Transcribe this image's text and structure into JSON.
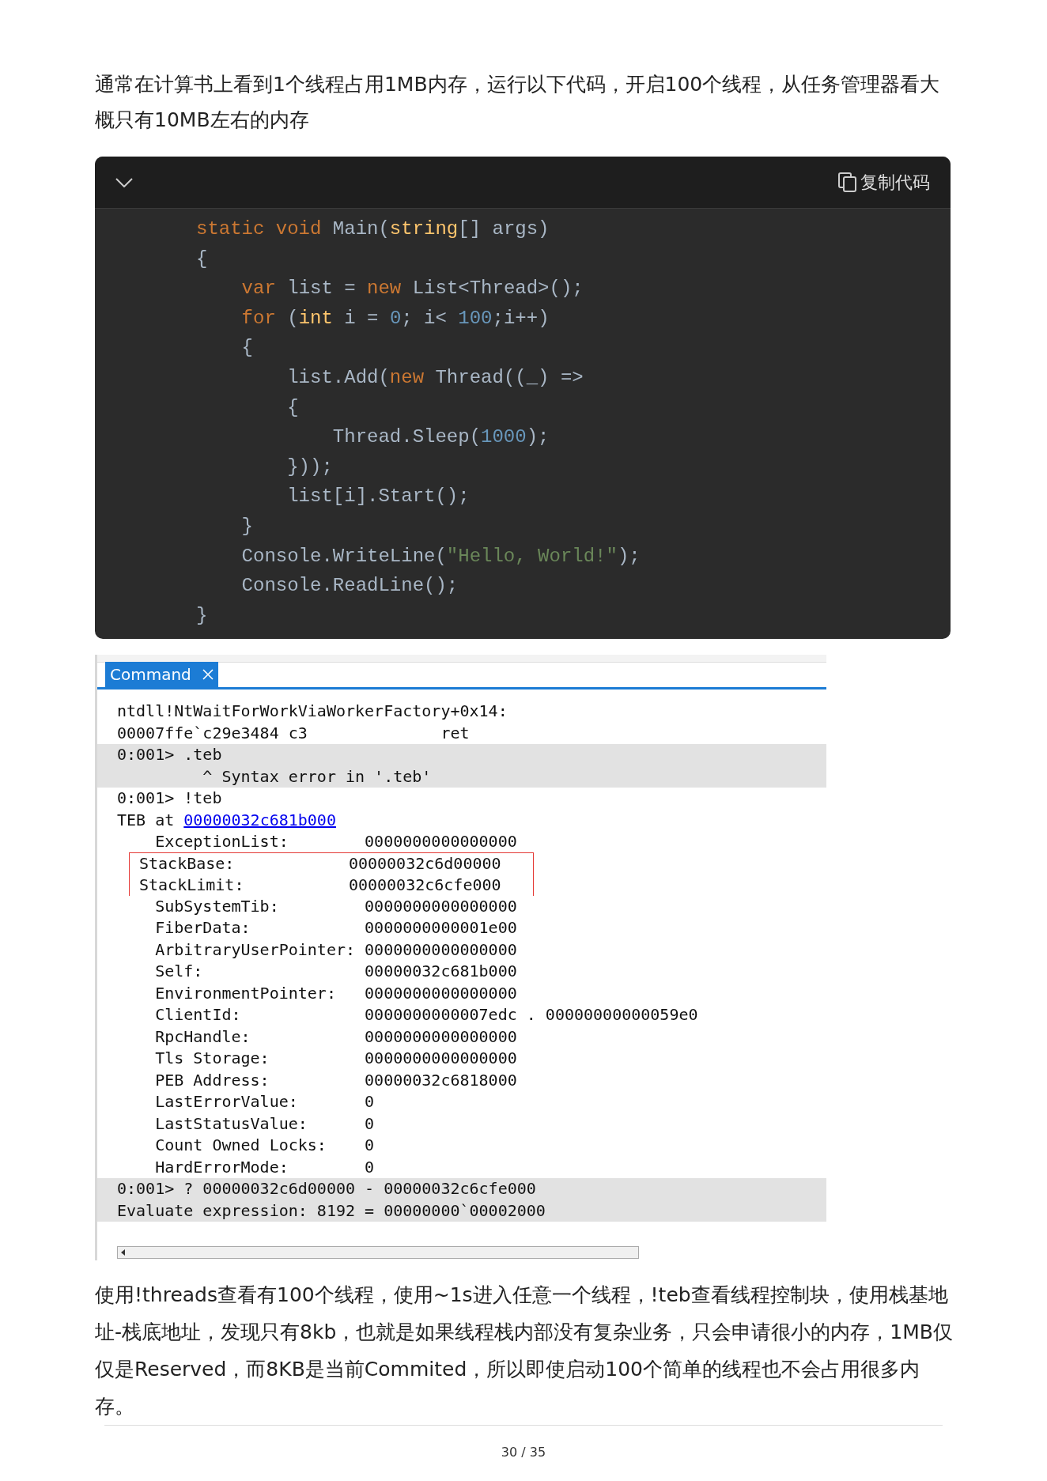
{
  "intro": "通常在计算书上看到1个线程占用1MB内存，运行以下代码，开启100个线程，从任务管理器看大概只有10MB左右的内存",
  "code_block": {
    "copy_label": "复制代码",
    "lines": [
      [
        {
          "kind": "keyword",
          "text": "static void "
        },
        {
          "kind": "plain",
          "text": "Main("
        },
        {
          "kind": "type",
          "text": "string"
        },
        {
          "kind": "plain",
          "text": "[] args)"
        }
      ],
      [
        {
          "kind": "plain",
          "text": "{"
        }
      ],
      [
        {
          "kind": "keyword",
          "text": "    var"
        },
        {
          "kind": "plain",
          "text": " list = "
        },
        {
          "kind": "keyword",
          "text": "new"
        },
        {
          "kind": "plain",
          "text": " List<Thread>();"
        }
      ],
      [
        {
          "kind": "keyword",
          "text": "    for"
        },
        {
          "kind": "plain",
          "text": " ("
        },
        {
          "kind": "type",
          "text": "int"
        },
        {
          "kind": "plain",
          "text": " i = "
        },
        {
          "kind": "number",
          "text": "0"
        },
        {
          "kind": "plain",
          "text": "; i< "
        },
        {
          "kind": "number",
          "text": "100"
        },
        {
          "kind": "plain",
          "text": ";i++)"
        }
      ],
      [
        {
          "kind": "plain",
          "text": "    {"
        }
      ],
      [
        {
          "kind": "plain",
          "text": "        list.Add("
        },
        {
          "kind": "keyword",
          "text": "new"
        },
        {
          "kind": "plain",
          "text": " Thread((_) =>"
        }
      ],
      [
        {
          "kind": "plain",
          "text": "        {"
        }
      ],
      [
        {
          "kind": "plain",
          "text": "            Thread.Sleep("
        },
        {
          "kind": "number",
          "text": "1000"
        },
        {
          "kind": "plain",
          "text": ");"
        }
      ],
      [
        {
          "kind": "plain",
          "text": "        }));"
        }
      ],
      [
        {
          "kind": "plain",
          "text": "        list[i].Start();"
        }
      ],
      [
        {
          "kind": "plain",
          "text": "    }"
        }
      ],
      [
        {
          "kind": "plain",
          "text": "    Console.WriteLine("
        },
        {
          "kind": "string",
          "text": "\"Hello, World!\""
        },
        {
          "kind": "plain",
          "text": ");"
        }
      ],
      [
        {
          "kind": "plain",
          "text": "    Console.ReadLine();"
        }
      ],
      [
        {
          "kind": "plain",
          "text": "}"
        }
      ]
    ]
  },
  "console": {
    "tab": {
      "label": "Command",
      "selected": true
    },
    "lines": [
      {
        "shaded": false,
        "highlighted": false,
        "parts": [
          {
            "text": "ntdll!NtWaitForWorkViaWorkerFactory+0x14:",
            "link": false
          }
        ]
      },
      {
        "shaded": false,
        "highlighted": false,
        "parts": [
          {
            "text": "00007ffe`c29e3484 c3              ret",
            "link": false
          }
        ]
      },
      {
        "shaded": true,
        "highlighted": false,
        "parts": [
          {
            "text": "0:001> .teb",
            "link": false
          }
        ]
      },
      {
        "shaded": true,
        "highlighted": false,
        "parts": [
          {
            "text": "         ^ Syntax error in '.teb'",
            "link": false
          }
        ]
      },
      {
        "shaded": false,
        "highlighted": false,
        "parts": [
          {
            "text": "0:001> !teb",
            "link": false
          }
        ]
      },
      {
        "shaded": false,
        "highlighted": false,
        "parts": [
          {
            "text": "TEB at ",
            "link": false
          },
          {
            "text": "00000032c681b000",
            "link": true
          }
        ]
      },
      {
        "shaded": false,
        "highlighted": false,
        "parts": [
          {
            "text": "    ExceptionList:        0000000000000000",
            "link": false
          }
        ]
      },
      {
        "shaded": false,
        "highlighted": true,
        "parts": [
          {
            "text": "StackBase:            00000032c6d00000",
            "link": false
          }
        ]
      },
      {
        "shaded": false,
        "highlighted": true,
        "parts": [
          {
            "text": "StackLimit:           00000032c6cfe000",
            "link": false
          }
        ]
      },
      {
        "shaded": false,
        "highlighted": false,
        "parts": [
          {
            "text": "    SubSystemTib:         0000000000000000",
            "link": false
          }
        ]
      },
      {
        "shaded": false,
        "highlighted": false,
        "parts": [
          {
            "text": "    FiberData:            0000000000001e00",
            "link": false
          }
        ]
      },
      {
        "shaded": false,
        "highlighted": false,
        "parts": [
          {
            "text": "    ArbitraryUserPointer: 0000000000000000",
            "link": false
          }
        ]
      },
      {
        "shaded": false,
        "highlighted": false,
        "parts": [
          {
            "text": "    Self:                 00000032c681b000",
            "link": false
          }
        ]
      },
      {
        "shaded": false,
        "highlighted": false,
        "parts": [
          {
            "text": "    EnvironmentPointer:   0000000000000000",
            "link": false
          }
        ]
      },
      {
        "shaded": false,
        "highlighted": false,
        "parts": [
          {
            "text": "    ClientId:             0000000000007edc . 00000000000059e0",
            "link": false
          }
        ]
      },
      {
        "shaded": false,
        "highlighted": false,
        "parts": [
          {
            "text": "    RpcHandle:            0000000000000000",
            "link": false
          }
        ]
      },
      {
        "shaded": false,
        "highlighted": false,
        "parts": [
          {
            "text": "    Tls Storage:          0000000000000000",
            "link": false
          }
        ]
      },
      {
        "shaded": false,
        "highlighted": false,
        "parts": [
          {
            "text": "    PEB Address:          00000032c6818000",
            "link": false
          }
        ]
      },
      {
        "shaded": false,
        "highlighted": false,
        "parts": [
          {
            "text": "    LastErrorValue:       0",
            "link": false
          }
        ]
      },
      {
        "shaded": false,
        "highlighted": false,
        "parts": [
          {
            "text": "    LastStatusValue:      0",
            "link": false
          }
        ]
      },
      {
        "shaded": false,
        "highlighted": false,
        "parts": [
          {
            "text": "    Count Owned Locks:    0",
            "link": false
          }
        ]
      },
      {
        "shaded": false,
        "highlighted": false,
        "parts": [
          {
            "text": "    HardErrorMode:        0",
            "link": false
          }
        ]
      },
      {
        "shaded": true,
        "highlighted": false,
        "parts": [
          {
            "text": "0:001> ? 00000032c6d00000 - 00000032c6cfe000",
            "link": false
          }
        ]
      },
      {
        "shaded": true,
        "highlighted": false,
        "parts": [
          {
            "text": "Evaluate expression: 8192 = 00000000`00002000",
            "link": false
          }
        ]
      }
    ]
  },
  "outro": "使用!threads查看有100个线程，使用~1s进入任意一个线程，!teb查看线程控制块，使用栈基地址-栈底地址，发现只有8kb，也就是如果线程栈内部没有复杂业务，只会申请很小的内存，1MB仅仅是Reserved，而8KB是当前Commited，所以即使启动100个简单的线程也不会占用很多内存。",
  "page_number": "30 / 35"
}
